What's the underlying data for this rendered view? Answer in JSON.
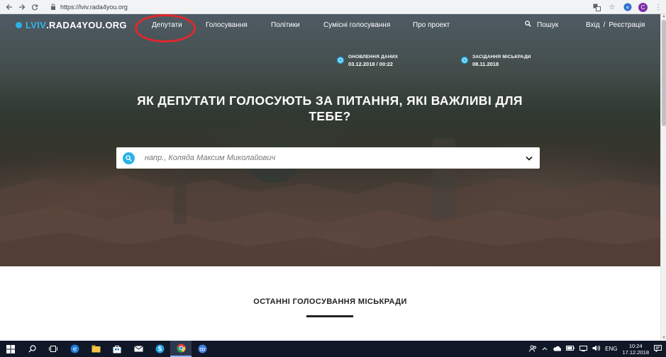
{
  "browser": {
    "url": "https://lviv.rada4you.org",
    "profile_initial": "C"
  },
  "site": {
    "logo_prefix": "LVIV",
    "logo_suffix": ".RADA4YOU.ORG",
    "nav": [
      {
        "label": "Депутати"
      },
      {
        "label": "Голосування"
      },
      {
        "label": "Політики"
      },
      {
        "label": "Сумісні голосування"
      },
      {
        "label": "Про проект"
      }
    ],
    "search_label": "Пошук",
    "login_label": "Вхід",
    "auth_separator": "/",
    "register_label": "Реєстрація",
    "accent_color": "#2ab3e6",
    "highlight_color": "#e0282d"
  },
  "info": {
    "update_label": "ОНОВЛЕННЯ ДАНИХ",
    "update_value": "03.12.2018 / 00:22",
    "session_label": "ЗАСІДАННЯ МІСЬКРАДИ",
    "session_value": "08.11.2018"
  },
  "hero": {
    "headline_line1": "ЯК ДЕПУТАТИ ГОЛОСУЮТЬ ЗА ПИТАННЯ, ЯКІ ВАЖЛИВІ ДЛЯ",
    "headline_line2": "ТЕБЕ?",
    "search_placeholder": "напр., Коляда Максим Миколайович"
  },
  "section": {
    "title": "ОСТАННІ ГОЛОСУВАННЯ МІСЬКРАДИ"
  },
  "taskbar": {
    "language": "ENG",
    "time": "10:24",
    "date": "17.12.2018"
  }
}
